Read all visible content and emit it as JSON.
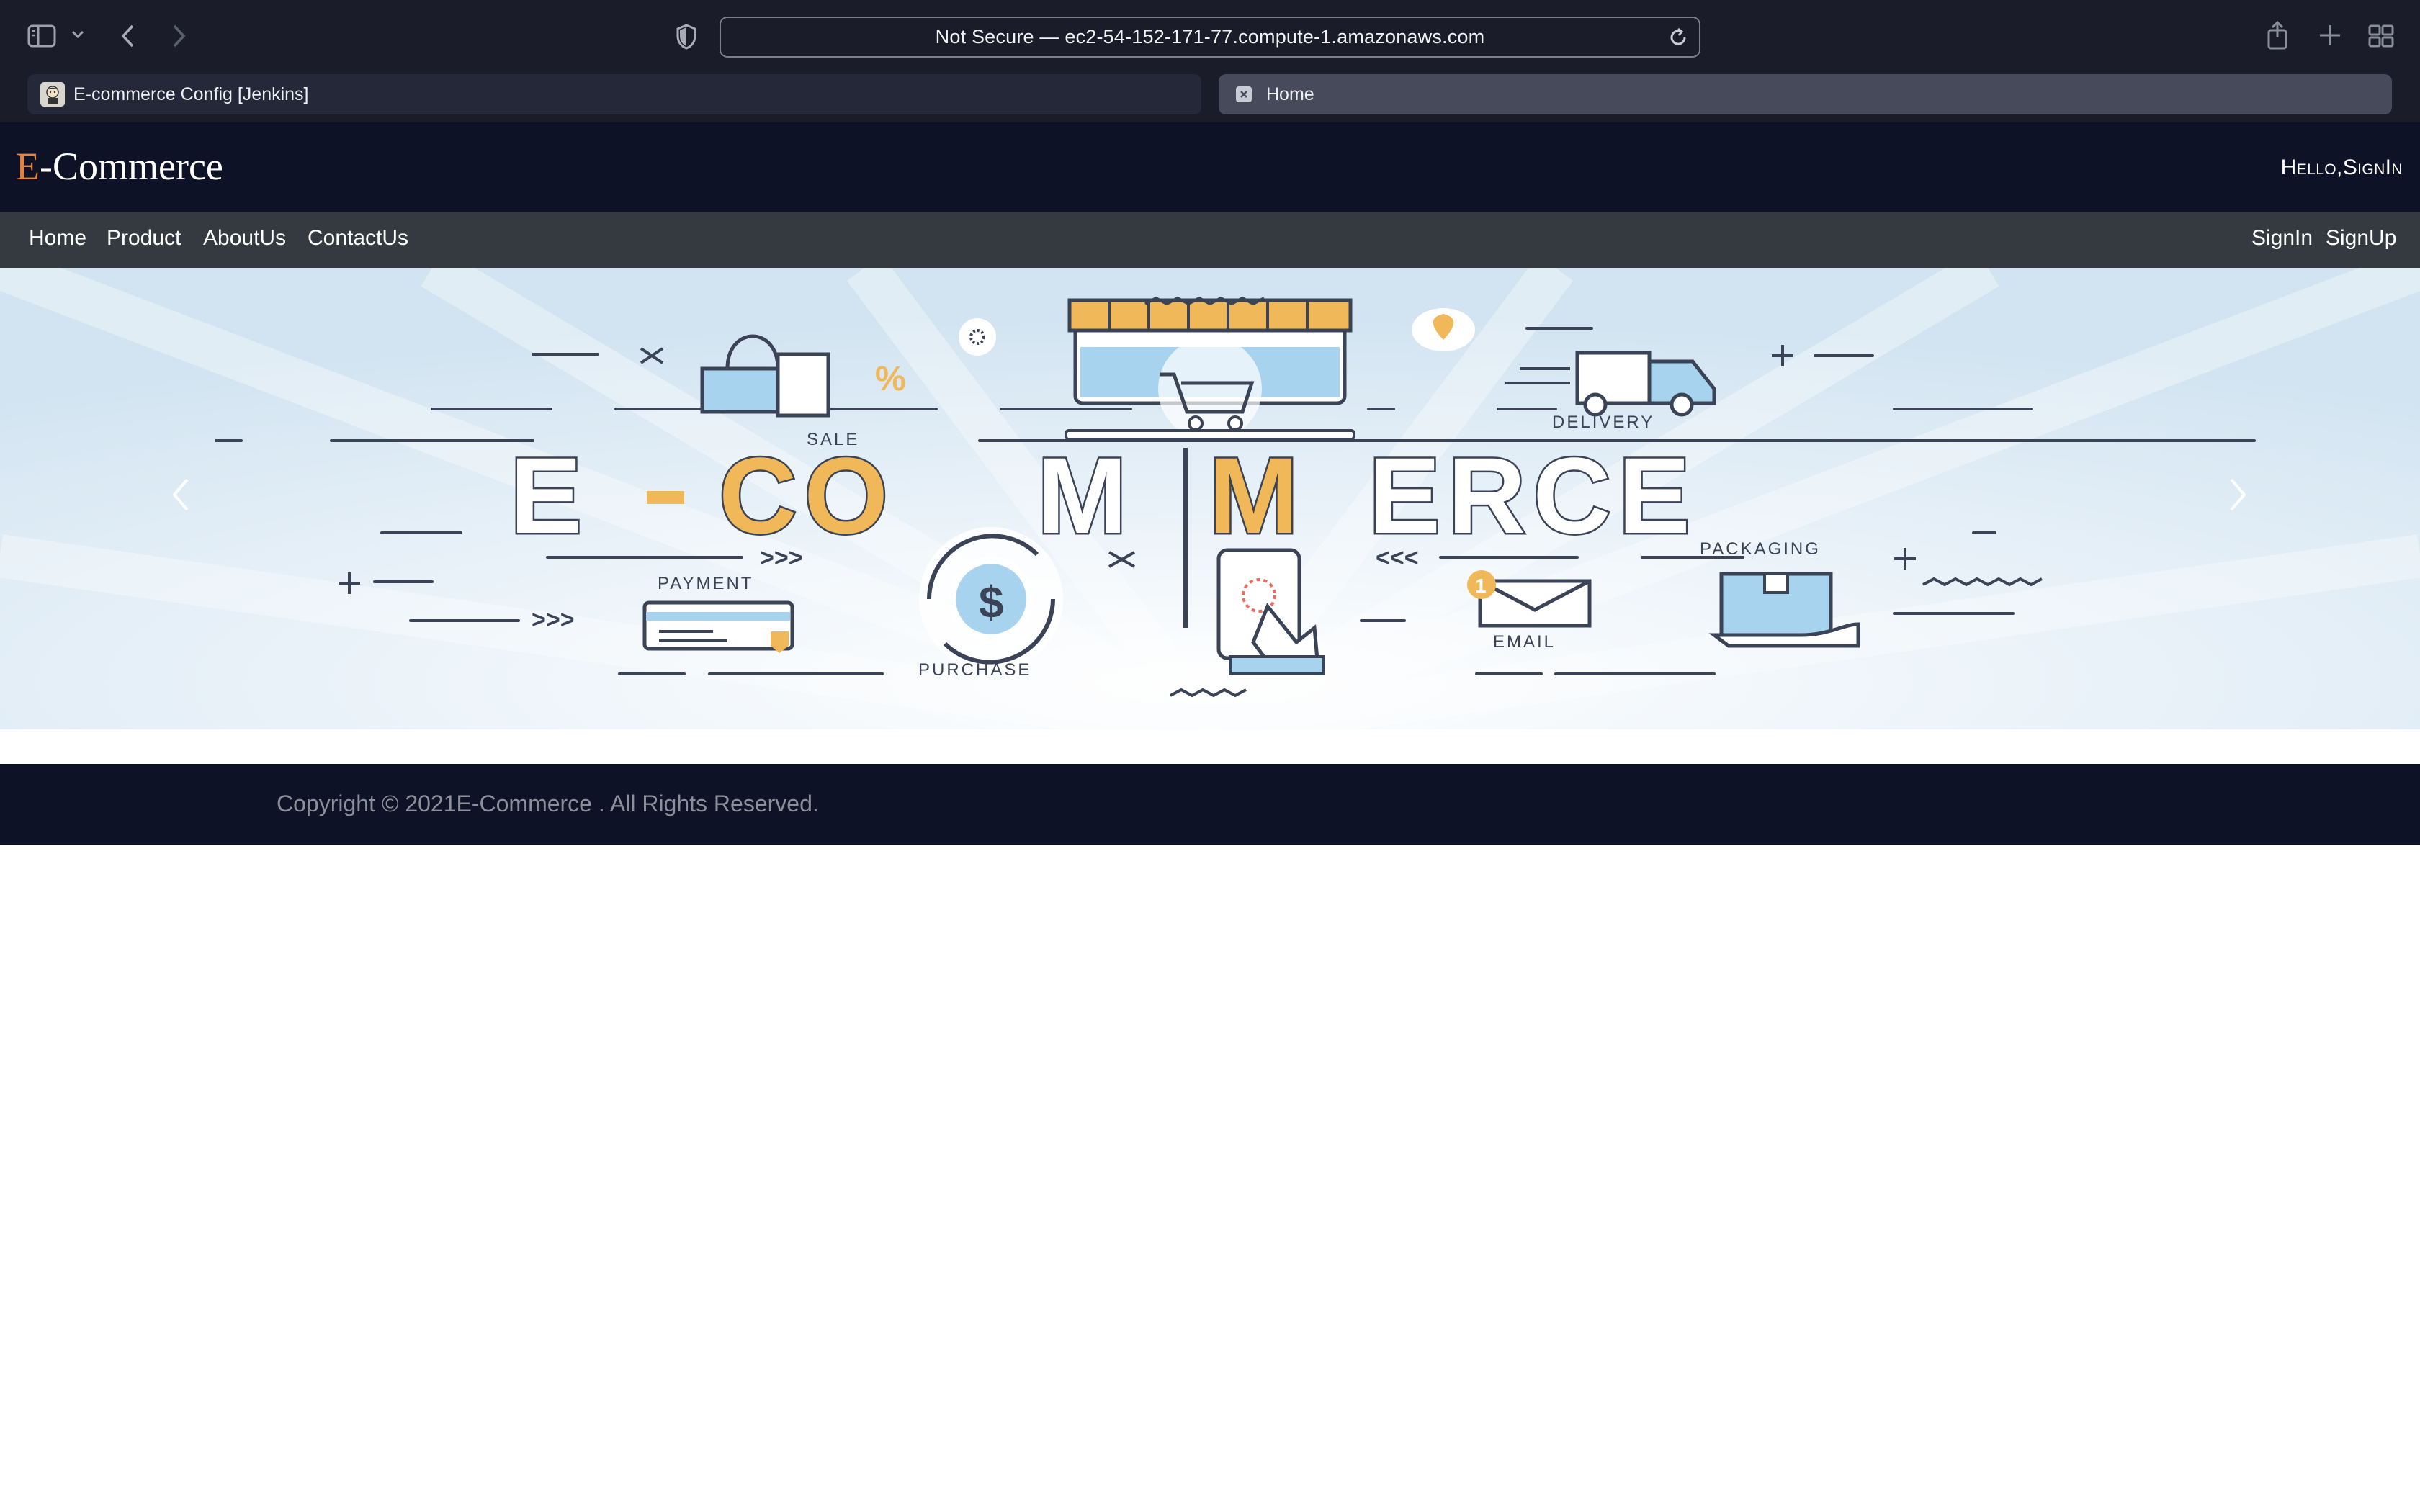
{
  "browser": {
    "url_text": "Not Secure — ec2-54-152-171-77.compute-1.amazonaws.com",
    "tabs": [
      {
        "label": "E-commerce Config [Jenkins]",
        "active": false
      },
      {
        "label": "Home",
        "active": true
      }
    ]
  },
  "header": {
    "logo_e": "E",
    "logo_rest": "-Commerce",
    "greeting": "Hello,SignIn",
    "accent_color": "#e7833a"
  },
  "nav": {
    "left": [
      "Home",
      "Product",
      "AboutUs",
      "ContactUs"
    ],
    "right": [
      "SignIn",
      "SignUp"
    ]
  },
  "hero": {
    "banner_word_e": "E",
    "banner_word_co": "CO",
    "banner_word_m1": "M",
    "banner_word_m2": "M",
    "banner_word_erce": "ERCE",
    "labels": {
      "sale": "SALE",
      "delivery": "DELIVERY",
      "payment": "PAYMENT",
      "purchase": "PURCHASE",
      "email": "EMAIL",
      "packaging": "PACKAGING"
    },
    "percent": "%",
    "dollar": "$",
    "email_badge": "1",
    "arrows_right": ">>>",
    "arrows_left": "<<<",
    "prev_icon": "chevron-left-icon",
    "next_icon": "chevron-right-icon"
  },
  "footer": {
    "copyright": "Copyright © 2021E-Commerce . All Rights Reserved."
  }
}
